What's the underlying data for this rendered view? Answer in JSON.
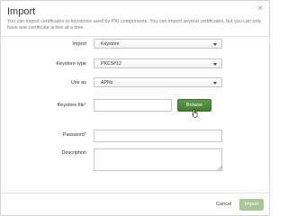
{
  "dialog": {
    "title": "Import",
    "close_label": "×",
    "description": "You can import certificates or keystores used by PKI components. You can import several certificates, but you can only have one certificate active at a time."
  },
  "form": {
    "import_label": "Import",
    "import_value": "Keystore",
    "keystore_type_label": "Keystore type",
    "keystore_type_value": "PKCS#12",
    "use_as_label": "Use as",
    "use_as_value": "APNs",
    "keystore_file_label": "Keystore file",
    "required_mark": "*",
    "browse_label": "Browse",
    "password_label": "Password",
    "description_label": "Description"
  },
  "footer": {
    "cancel_label": "Cancel",
    "import_label": "Import"
  },
  "colors": {
    "browse_green": "#4f8a3d",
    "import_disabled_green": "#a8c69a",
    "required_red": "#d0584f"
  },
  "icons": {
    "cursor": "hand-pointer-icon",
    "close": "close-icon",
    "dropdown": "chevron-down-icon",
    "resize": "resize-grip-icon"
  }
}
